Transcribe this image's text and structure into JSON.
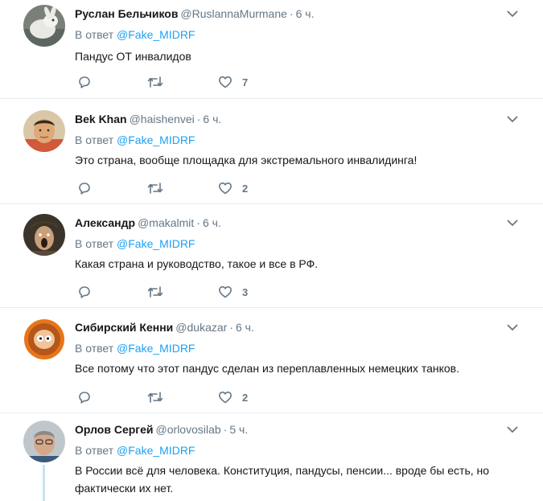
{
  "colors": {
    "accent": "#1da1f2",
    "muted": "#657786",
    "text": "#14171a",
    "divider": "#e6ecf0"
  },
  "tweets": [
    {
      "name": "Руслан Бельчиков",
      "handle": "@RuslannaMurmane",
      "sep": "·",
      "time": "6 ч.",
      "reply_prefix": "В ответ",
      "reply_to": "@Fake_MIDRF",
      "text": "Пандус ОТ инвалидов",
      "likes": "7",
      "avatar": "rabbit-avatar"
    },
    {
      "name": "Bek Khan",
      "handle": "@haishenvei",
      "sep": "·",
      "time": "6 ч.",
      "reply_prefix": "В ответ",
      "reply_to": "@Fake_MIDRF",
      "text": "Это страна, вообще площадка для экстремального инвалидинга!",
      "likes": "2",
      "avatar": "man-avatar"
    },
    {
      "name": "Александр",
      "handle": "@makalmit",
      "sep": "·",
      "time": "6 ч.",
      "reply_prefix": "В ответ",
      "reply_to": "@Fake_MIDRF",
      "text": "Какая страна и руководство, такое и все в РФ.",
      "likes": "3",
      "avatar": "screaming-man-avatar"
    },
    {
      "name": "Сибирский Кенни",
      "handle": "@dukazar",
      "sep": "·",
      "time": "6 ч.",
      "reply_prefix": "В ответ",
      "reply_to": "@Fake_MIDRF",
      "text": "Все потому что этот пандус сделан из переплавленных немецких танков.",
      "likes": "2",
      "avatar": "kenny-avatar"
    },
    {
      "name": "Орлов Сергей",
      "handle": "@orlovosilab",
      "sep": "·",
      "time": "5 ч.",
      "reply_prefix": "В ответ",
      "reply_to": "@Fake_MIDRF",
      "text_line1": "В России всё для человека. Конституция, пандусы, пенсии... вроде бы есть, но",
      "text_line2": "фактически их нет.",
      "avatar": "older-man-avatar"
    }
  ]
}
